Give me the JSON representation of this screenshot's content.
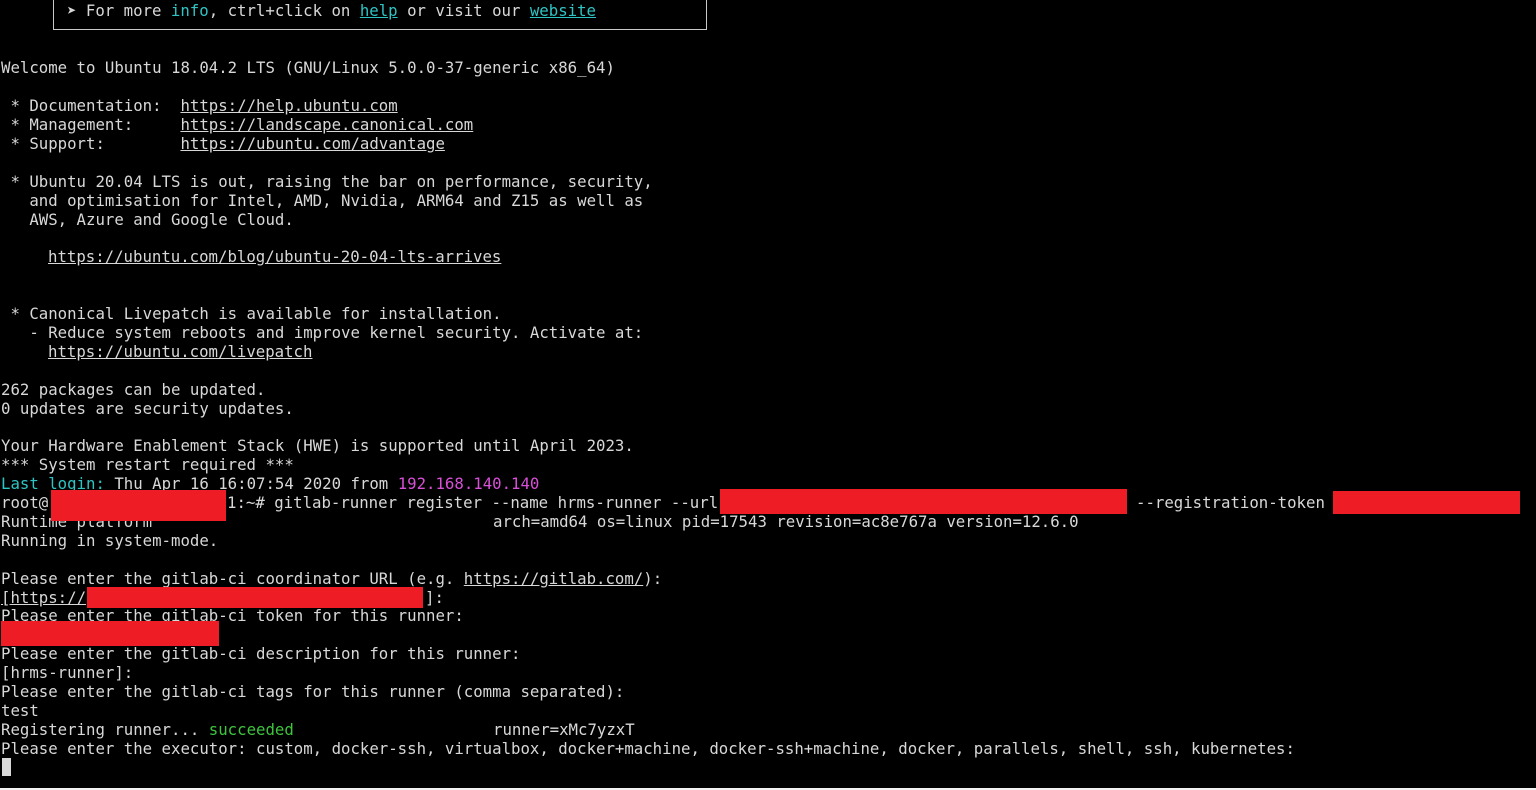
{
  "banner": {
    "arrow": "➤",
    "for_more": "For more",
    "info": "info",
    "ctrl_click_on": ", ctrl+click on",
    "help": "help",
    "or_visit_our": "or visit our",
    "website": "website"
  },
  "motd": {
    "welcome": "Welcome to Ubuntu 18.04.2 LTS (GNU/Linux 5.0.0-37-generic x86_64)",
    "doc_label": " * Documentation:  ",
    "doc_url": "https://help.ubuntu.com",
    "mgmt_label": " * Management:     ",
    "mgmt_url": "https://landscape.canonical.com",
    "support_label": " * Support:        ",
    "support_url": "https://ubuntu.com/advantage",
    "news_1": " * Ubuntu 20.04 LTS is out, raising the bar on performance, security,",
    "news_2": "   and optimisation for Intel, AMD, Nvidia, ARM64 and Z15 as well as",
    "news_3": "   AWS, Azure and Google Cloud.",
    "news_url": "https://ubuntu.com/blog/ubuntu-20-04-lts-arrives",
    "livepatch_1": " * Canonical Livepatch is available for installation.",
    "livepatch_2": "   - Reduce system reboots and improve kernel security. Activate at:",
    "livepatch_url": "https://ubuntu.com/livepatch",
    "packages": "262 packages can be updated.",
    "security": "0 updates are security updates.",
    "hwe": "Your Hardware Enablement Stack (HWE) is supported until April 2023.",
    "restart": "*** System restart required ***"
  },
  "last_login": {
    "label": "Last login:",
    "date": " Thu Apr 16 16:07:54 2020 from ",
    "ip": "192.168.140.140"
  },
  "session": {
    "prompt_user": "root@",
    "prompt_tail": "1:~# ",
    "command": "gitlab-runner register --name hrms-runner --url",
    "token_flag": "--registration-token",
    "runtime_label": "Runtime platform",
    "runtime_info": "arch=amd64 os=linux pid=17543 revision=ac8e767a version=12.6.0",
    "system_mode": "Running in system-mode.",
    "url_prompt": "Please enter the gitlab-ci coordinator URL (e.g. ",
    "url_example": "https://gitlab.com/",
    "url_prompt_end": "):",
    "url_default_open": "[",
    "url_default_scheme": "https://",
    "url_default_close": "]:",
    "token_prompt": "Please enter the gitlab-ci token for this runner:",
    "desc_prompt": "Please enter the gitlab-ci description for this runner:",
    "desc_default": "[hrms-runner]:",
    "tags_prompt": "Please enter the gitlab-ci tags for this runner (comma separated):",
    "tags_value": "test",
    "registering": "Registering runner... ",
    "succeeded": "succeeded",
    "runner_id": "runner=xMc7yzxT",
    "executor_prompt": "Please enter the executor: custom, docker-ssh, virtualbox, docker+machine, docker-ssh+machine, docker, parallels, shell, ssh, kubernetes:"
  },
  "colors": {
    "background": "#000000",
    "text": "#d8d8d8",
    "cyan": "#2fc4c4",
    "magenta": "#d84fd8",
    "green": "#3ec43e",
    "redaction": "#ee1c24"
  }
}
